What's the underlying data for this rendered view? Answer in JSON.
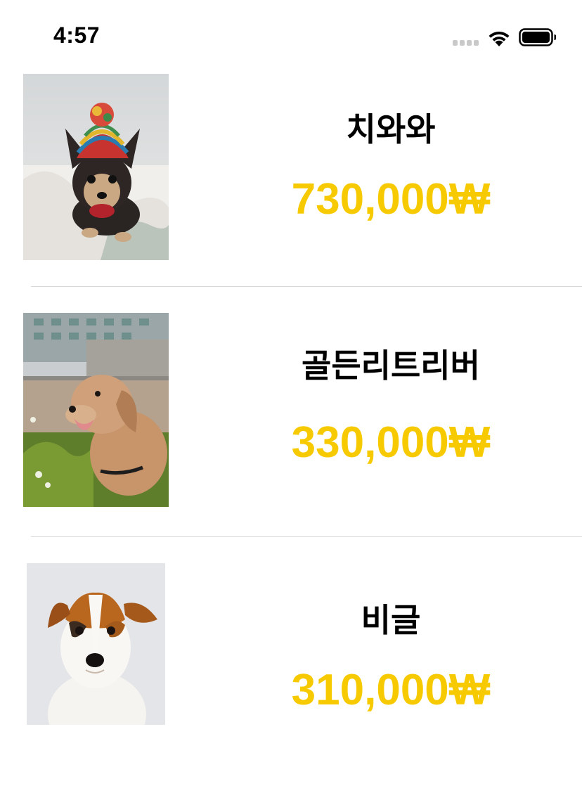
{
  "status_bar": {
    "time": "4:57",
    "icons": [
      "signal-icon",
      "wifi-icon",
      "battery-icon"
    ]
  },
  "colors": {
    "price": "#f7ca00",
    "name": "#000000",
    "separator": "#d9d9d9"
  },
  "items": [
    {
      "name": "치와와",
      "price": "730,000₩",
      "image": "chihuahua-photo"
    },
    {
      "name": "골든리트리버",
      "price": "330,000₩",
      "image": "golden-retriever-photo"
    },
    {
      "name": "비글",
      "price": "310,000₩",
      "image": "beagle-photo"
    }
  ]
}
